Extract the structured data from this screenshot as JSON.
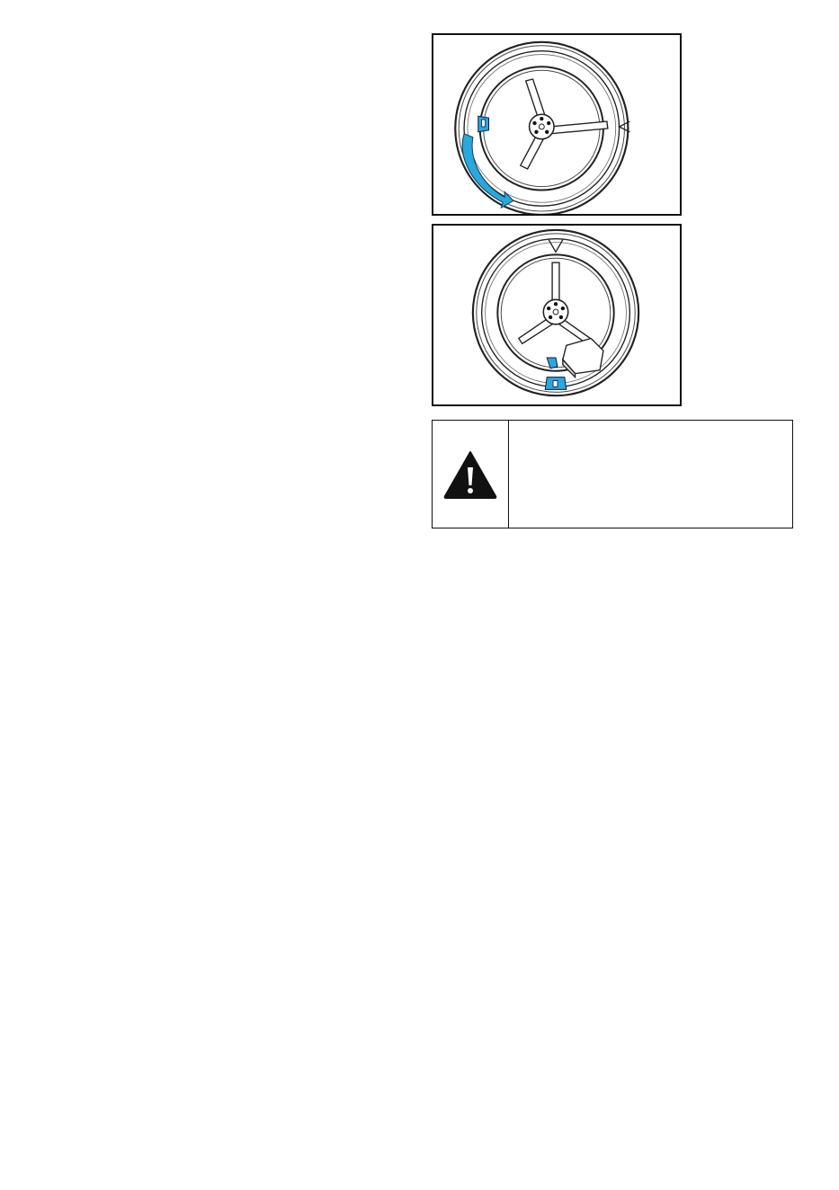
{
  "figures": [
    {
      "id": "drum-rotation",
      "icon": "drum-rotate-arrow-icon",
      "accent_color": "#2aa7dc"
    },
    {
      "id": "drum-paddle-install",
      "icon": "drum-paddle-icon",
      "accent_color": "#2aa7dc"
    }
  ],
  "warning": {
    "icon": "warning-triangle-icon",
    "text": ""
  },
  "colors": {
    "accent": "#2aa7dc",
    "line": "#111111",
    "background": "#ffffff"
  }
}
